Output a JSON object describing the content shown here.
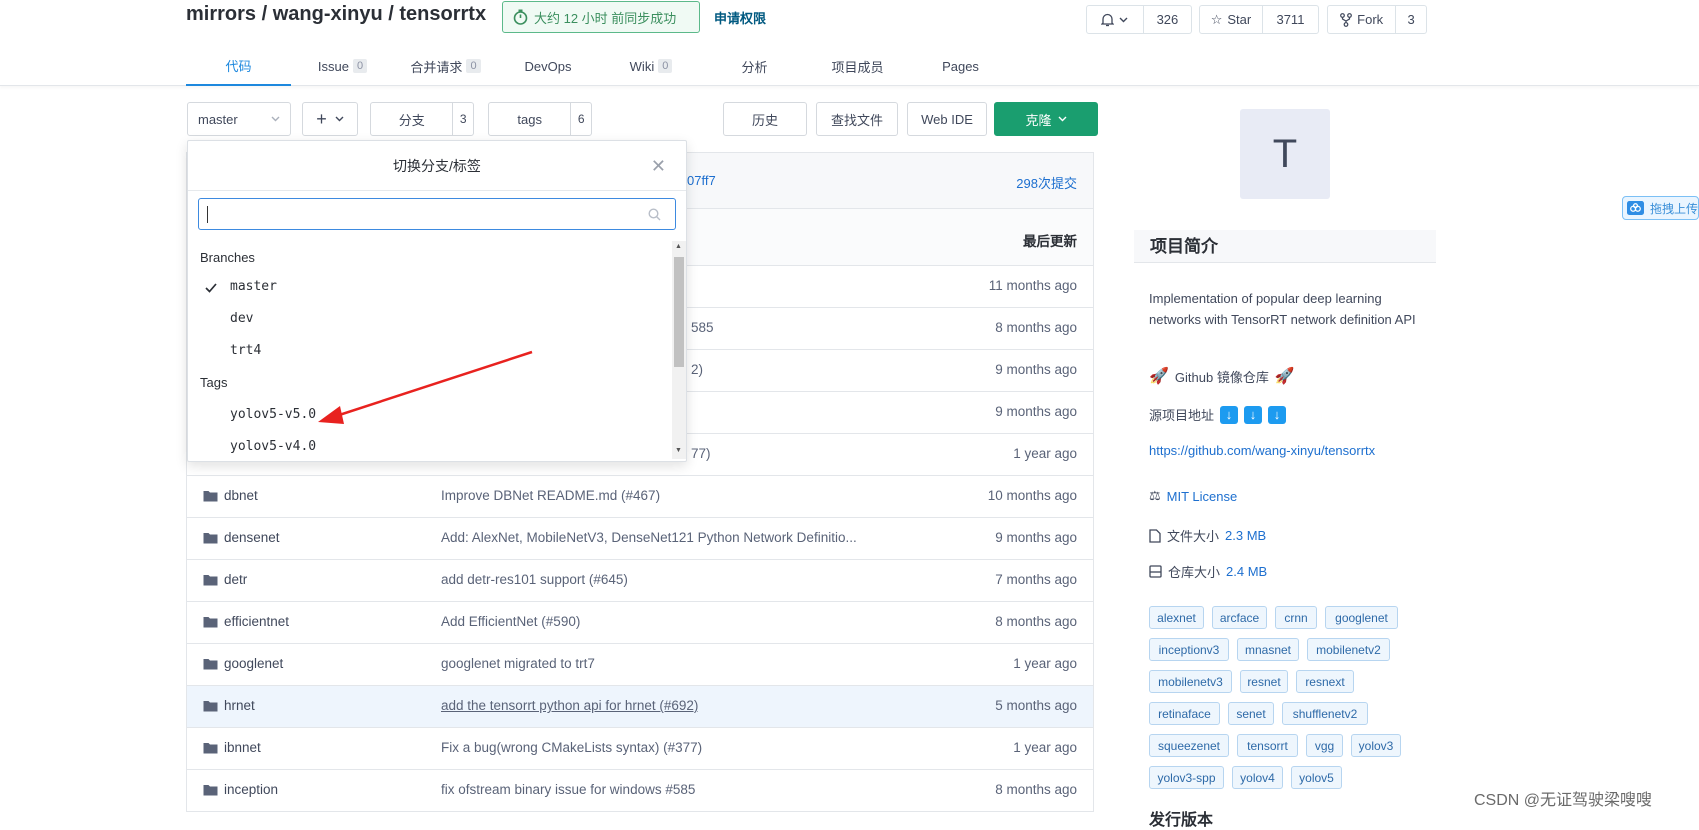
{
  "repo": {
    "title": "mirrors / wang-xinyu / tensorrtx",
    "sync_status": "大约 12 小时 前同步成功",
    "apply_permission": "申请权限"
  },
  "actions": {
    "watch_count": "326",
    "star_label": "Star",
    "star_count": "3711",
    "fork_label": "Fork",
    "fork_count": "3"
  },
  "tabs": [
    {
      "label": "代码",
      "count": null,
      "active": true
    },
    {
      "label": "Issue",
      "count": "0"
    },
    {
      "label": "合并请求",
      "count": "0"
    },
    {
      "label": "DevOps",
      "count": null
    },
    {
      "label": "Wiki",
      "count": "0"
    },
    {
      "label": "分析",
      "count": null
    },
    {
      "label": "项目成员",
      "count": null
    },
    {
      "label": "Pages",
      "count": null
    }
  ],
  "toolbar": {
    "branch": "master",
    "add_label": "+",
    "branches_label": "分支",
    "branches_count": "3",
    "tags_label": "tags",
    "tags_count": "6",
    "history": "历史",
    "find_file": "查找文件",
    "web_ide": "Web IDE",
    "clone": "克隆"
  },
  "commit_bar": {
    "hash_fragment": "07ff7",
    "commits": "298次提交"
  },
  "table": {
    "last_update_header": "最后更新",
    "partial_rows": [
      {
        "msg_fragment": "",
        "time": "11 months ago"
      },
      {
        "msg_fragment": "585",
        "time": "8 months ago"
      },
      {
        "msg_fragment": "2)",
        "time": "9 months ago"
      },
      {
        "msg_fragment": "",
        "time": "9 months ago"
      },
      {
        "msg_fragment": "77)",
        "time": "1 year ago"
      }
    ],
    "rows": [
      {
        "name": "dbnet",
        "msg": "Improve DBNet README.md (#467)",
        "time": "10 months ago"
      },
      {
        "name": "densenet",
        "msg": "Add: AlexNet, MobileNetV3, DenseNet121 Python Network Definitio...",
        "time": "9 months ago"
      },
      {
        "name": "detr",
        "msg": "add detr-res101 support (#645)",
        "time": "7 months ago"
      },
      {
        "name": "efficientnet",
        "msg": "Add EfficientNet (#590)",
        "time": "8 months ago"
      },
      {
        "name": "googlenet",
        "msg": "googlenet migrated to trt7",
        "time": "1 year ago"
      },
      {
        "name": "hrnet",
        "msg": "add the tensorrt python api for hrnet (#692)",
        "time": "5 months ago"
      },
      {
        "name": "ibnnet",
        "msg": "Fix a bug(wrong CMakeLists syntax) (#377)",
        "time": "1 year ago"
      },
      {
        "name": "inception",
        "msg": "fix ofstream binary issue for windows #585",
        "time": "8 months ago"
      }
    ]
  },
  "dropdown": {
    "title": "切换分支/标签",
    "search_value": "",
    "branches_label": "Branches",
    "branches": [
      "master",
      "dev",
      "trt4"
    ],
    "selected_branch": "master",
    "tags_label": "Tags",
    "tags": [
      "yolov5-v5.0",
      "yolov5-v4.0"
    ]
  },
  "sidebar": {
    "avatar_letter": "T",
    "about_title": "项目简介",
    "description": "Implementation of popular deep learning networks with TensorRT network definition API",
    "mirror_label": "Github 镜像仓库",
    "source_label": "源项目地址",
    "source_url": "https://github.com/wang-xinyu/tensorrtx",
    "license": "MIT License",
    "file_size_label": "文件大小",
    "file_size": "2.3 MB",
    "repo_size_label": "仓库大小",
    "repo_size": "2.4 MB",
    "topics": [
      "alexnet",
      "arcface",
      "crnn",
      "googlenet",
      "inceptionv3",
      "mnasnet",
      "mobilenetv2",
      "mobilenetv3",
      "resnet",
      "resnext",
      "retinaface",
      "senet",
      "shufflenetv2",
      "squeezenet",
      "tensorrt",
      "vgg",
      "yolov3",
      "yolov3-spp",
      "yolov4",
      "yolov5"
    ],
    "next_section": "发行版本"
  },
  "overlay": {
    "baidu_label": "拖拽上传",
    "watermark": "CSDN @无证驾驶梁嗖嗖"
  },
  "colors": {
    "accent": "#1d88de",
    "clone_green": "#1a9e6f",
    "annotation_arrow": "#e8221f"
  }
}
